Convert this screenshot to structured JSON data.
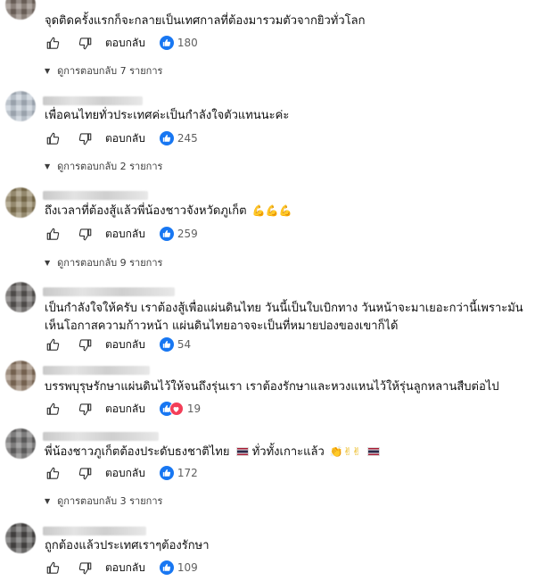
{
  "reply_label": "ตอบกลับ",
  "comments": [
    {
      "text": "จุดติดครั้งแรกก็จะกลายเป็นเทศกาลที่ต้องมารวมตัวจากยิวทั่วโลก",
      "reactions": "180",
      "replies": "ดูการตอบกลับ 7 รายการ"
    },
    {
      "text": "เพื่อคนไทยทั่วประเทศค่ะเป็นกำลังใจตัวแทนนะค่ะ",
      "reactions": "245",
      "replies": "ดูการตอบกลับ 2 รายการ"
    },
    {
      "text": "ถึงเวลาที่ต้องสู้แล้วพี่น้องชาวจังหวัดภูเก็ต",
      "emoji": "💪💪💪",
      "reactions": "259",
      "replies": "ดูการตอบกลับ 9 รายการ"
    },
    {
      "text_line1": "เป็นกำลังใจให้ครับ เราต้องสู้เพื่อแผ่นดินไทย วันนี้เป็นใบเบิกทาง วันหน้าจะมาเยอะกว่านี้เพราะมัน",
      "text_line2": "เห็นโอกาสความก้าวหน้า แผ่นดินไทยอาจจะเป็นที่หมายปองของเขาก็ได้",
      "reactions": "54"
    },
    {
      "text": "บรรพบุรุษรักษาแผ่นดินไว้ให้จนถึงรุ่นเรา เราต้องรักษาและหวงแหนไว้ให้รุ่นลูกหลานสืบต่อไป",
      "reactions": "19"
    },
    {
      "text_a": "พี่น้องชาวภูเก็ตต้องประดับธงชาติไทย",
      "text_b": " ทั่วทั้งเกาะแล้ว ",
      "emoji": "👏✌✌",
      "reactions": "172",
      "replies": "ดูการตอบกลับ 3 รายการ"
    },
    {
      "text": "ถูกต้องแล้วประเทศเราๆต้องรักษา",
      "reactions": "109"
    }
  ],
  "colors": {
    "reaction_like": "#1877f2",
    "reaction_love": "#f33e58"
  }
}
